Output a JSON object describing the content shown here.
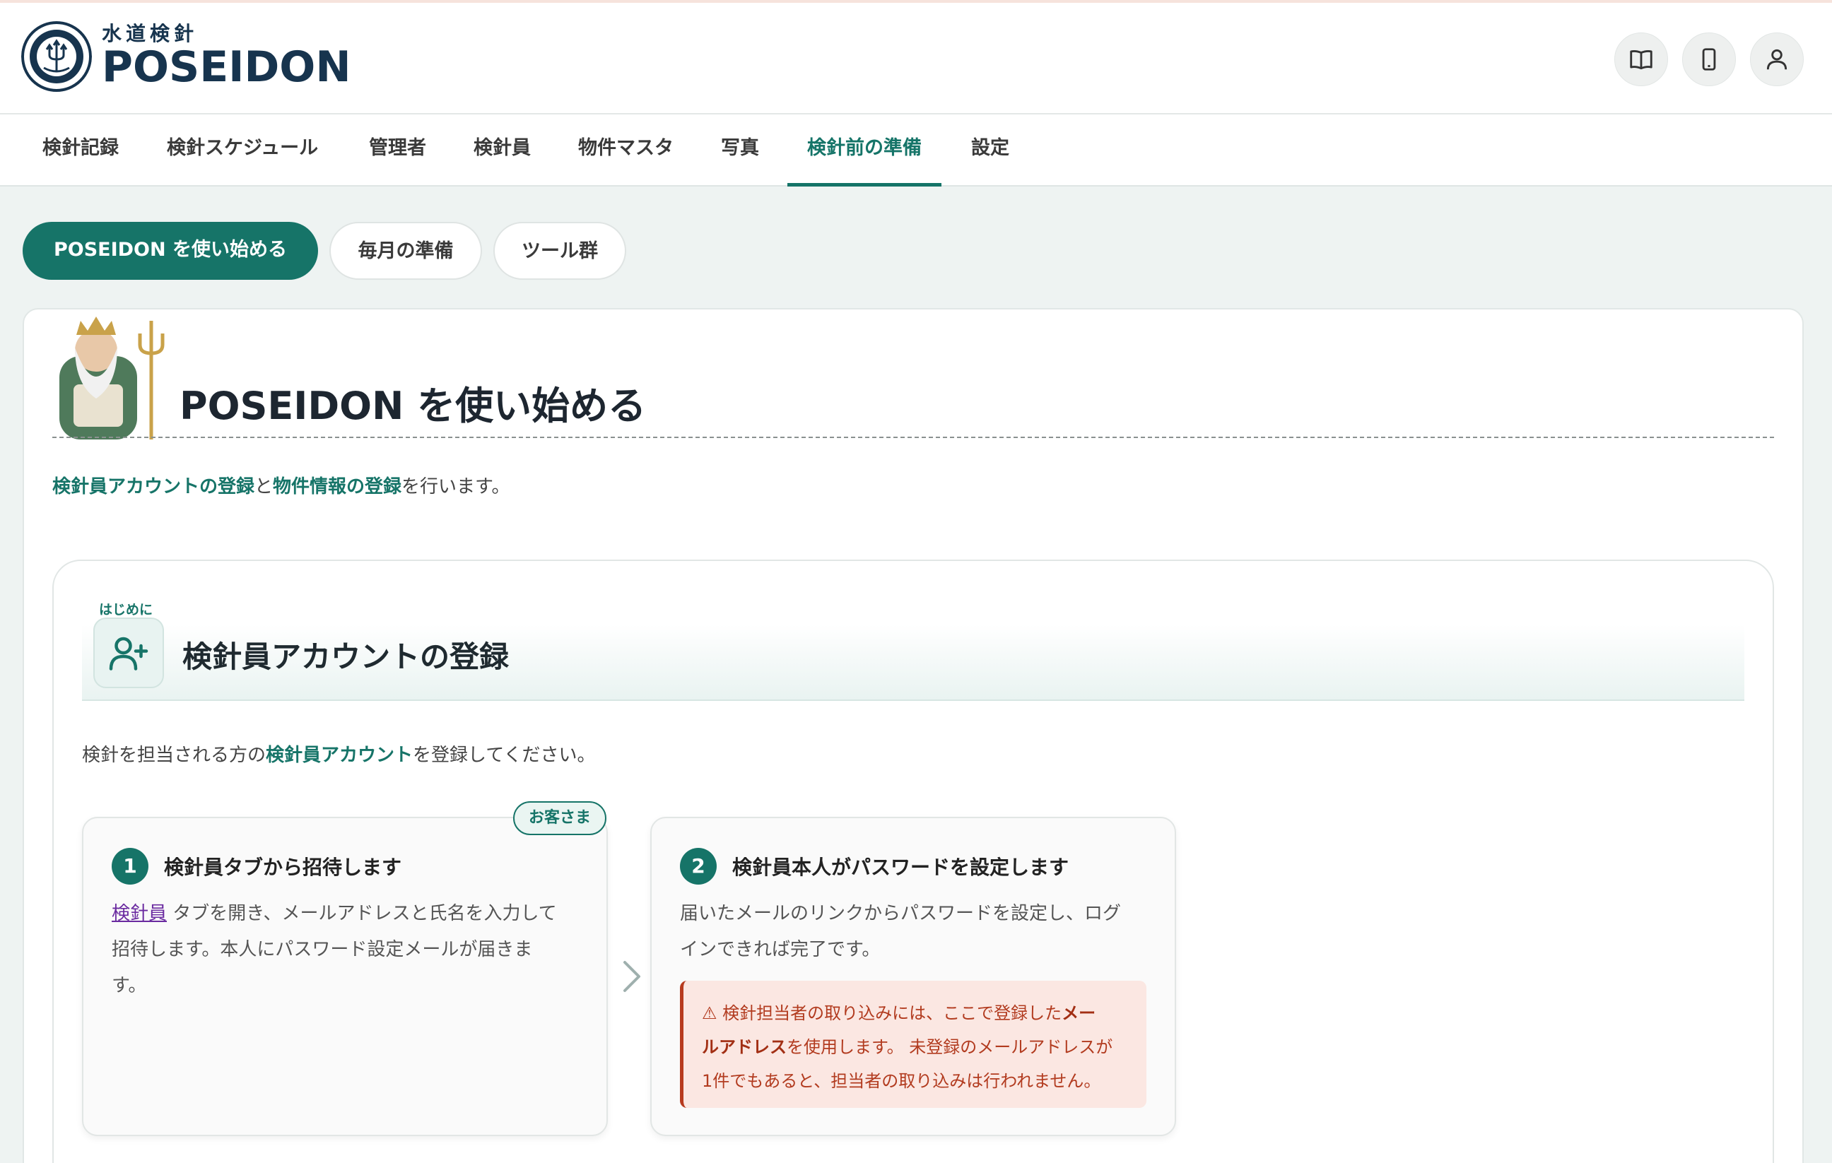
{
  "app": {
    "logo_sub": "水道検針",
    "logo_main": "POSEIDON"
  },
  "header_icons": [
    "book-icon",
    "mobile-device-icon",
    "user-icon"
  ],
  "nav": {
    "tabs": [
      "検針記録",
      "検針スケジュール",
      "管理者",
      "検針員",
      "物件マスタ",
      "写真",
      "検針前の準備",
      "設定"
    ],
    "active": "検針前の準備"
  },
  "subtabs": {
    "items": [
      "POSEIDON を使い始める",
      "毎月の準備",
      "ツール群"
    ],
    "active": "POSEIDON を使い始める"
  },
  "page": {
    "title": "POSEIDON を使い始める",
    "intro": {
      "link1": "検針員アカウントの登録",
      "conj": "と",
      "link2": "物件情報の登録",
      "tail": "を行います。"
    }
  },
  "section": {
    "kicker": "はじめに",
    "title": "検針員アカウントの登録",
    "desc_pre": "検針を担当される方の",
    "desc_hl": "検針員アカウント",
    "desc_post": "を登録してください。",
    "badge": "お客さま",
    "steps": [
      {
        "num": "1",
        "title": "検針員タブから招待します",
        "link": "検針員",
        "body_line1": " タブを開き、メールアドレスと氏名を入力して",
        "body_line2": "招待します。本人にパスワード設定メールが届きま",
        "body_line3": "す。"
      },
      {
        "num": "2",
        "title": "検針員本人がパスワードを設定します",
        "body_line1": "届いたメールのリンクからパスワードを設定し、ログ",
        "body_line2": "インできれば完了です。",
        "warning": {
          "pre": "⚠ 検針担当者の取り込みには、ここで登録した",
          "bold1": "メー",
          "bold2": "ルアドレス",
          "mid": "を使用します。 未登録のメールアドレスが",
          "line3": "1件でもあると、担当者の取り込みは行われません。"
        }
      }
    ]
  },
  "colors": {
    "accent": "#167468",
    "brand_navy": "#17344e",
    "warning_bg": "#fbe7e2",
    "warning_text": "#b23b1f",
    "page_bg": "#eef3f2"
  }
}
